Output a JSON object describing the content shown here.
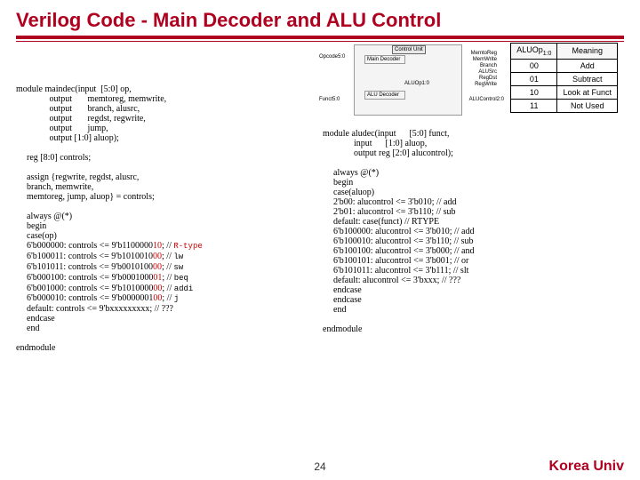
{
  "title": "Verilog Code - Main Decoder and ALU Control",
  "diagram": {
    "unit_label": "Control Unit",
    "opcode": "Opcode5:0",
    "main": "Main Decoder",
    "sig_memtoreg": "MemtoReg",
    "sig_memwrite": "MemWrite",
    "sig_branch": "Branch",
    "sig_alusrc": "ALUSrc",
    "sig_regdst": "RegDst",
    "sig_regwrite": "RegWrite",
    "aluop": "ALUOp1:0",
    "aludec": "ALU Decoder",
    "funct": "Funct5:0",
    "aluctrl": "ALUControl2:0"
  },
  "aluop_table": {
    "h1": "ALUOp",
    "h1sub": "1:0",
    "h2": "Meaning",
    "rows": [
      {
        "op": "00",
        "meaning": "Add"
      },
      {
        "op": "01",
        "meaning": "Subtract"
      },
      {
        "op": "10",
        "meaning": "Look at Funct"
      },
      {
        "op": "11",
        "meaning": "Not Used"
      }
    ]
  },
  "maindec": {
    "l0": "module maindec(input  [5:0] op,",
    "l1": "               output       memtoreg, memwrite,",
    "l2": "               output       branch, alusrc,",
    "l3": "               output       regdst, regwrite,",
    "l4": "               output       jump,",
    "l5": "               output [1:0] aluop);",
    "l6": "reg [8:0] controls;",
    "l7": "assign {regwrite, regdst, alusrc,",
    "l8": "        branch, memwrite,",
    "l9": "        memtoreg, jump, aluop} = controls;",
    "l10": "always @(*)",
    "l11": "begin",
    "l12": " case(op)",
    "l13a": "  6'b000000: controls <= 9'b1100000",
    "l13b": "10",
    "l13c": "; // ",
    "l13d": "R-type",
    "l14a": "  6'b100011: controls <= 9'b1010010",
    "l14b": "00",
    "l14c": "; // ",
    "l14d": "lw",
    "l15a": "  6'b101011: controls <= 9'b0010100",
    "l15b": "00",
    "l15c": "; // ",
    "l15d": "sw",
    "l16a": "  6'b000100: controls <= 9'b0001000",
    "l16b": "01",
    "l16c": "; // ",
    "l16d": "beq",
    "l17a": "  6'b001000: controls <= 9'b1010000",
    "l17b": "00",
    "l17c": "; // ",
    "l17d": "addi",
    "l18a": "  6'b000010: controls <= 9'b0000001",
    "l18b": "00",
    "l18c": "; // ",
    "l18d": "j",
    "l19": "  default:    controls <= 9'bxxxxxxxxx; // ???",
    "l20": " endcase",
    "l21": "end",
    "l22": "endmodule"
  },
  "aludec": {
    "l0": "module aludec(input      [5:0] funct,",
    "l1": "              input      [1:0] aluop,",
    "l2": "              output reg [2:0] alucontrol);",
    "l3": "always @(*)",
    "l4": "begin",
    "l5": " case(aluop)",
    "l6": "  2'b00: alucontrol <= 3'b010;  // add",
    "l7": "  2'b01: alucontrol <= 3'b110;  // sub",
    "l8": "  default: case(funct)          // RTYPE",
    "l9": "      6'b100000: alucontrol <= 3'b010; // add",
    "l10": "      6'b100010: alucontrol <= 3'b110; // sub",
    "l11": "      6'b100100: alucontrol <= 3'b000; // and",
    "l12": "      6'b100101: alucontrol <= 3'b001; // or",
    "l13": "      6'b101011: alucontrol <= 3'b111; // slt",
    "l14": "      default:   alucontrol <= 3'bxxx; // ???",
    "l15": "     endcase",
    "l16": " endcase",
    "l17": "end",
    "l18": "endmodule"
  },
  "page": "24",
  "univ": "Korea Univ"
}
